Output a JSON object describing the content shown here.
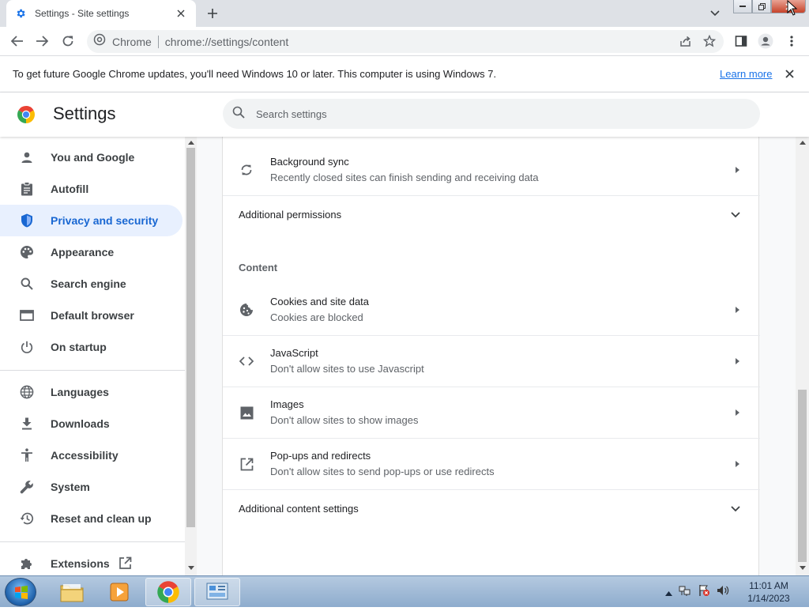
{
  "browser": {
    "tab_title": "Settings - Site settings",
    "omnibox_chip": "Chrome",
    "url": "chrome://settings/content"
  },
  "infobar": {
    "message": "To get future Google Chrome updates, you'll need Windows 10 or later. This computer is using Windows 7.",
    "learn_more": "Learn more"
  },
  "settings": {
    "title": "Settings",
    "search_placeholder": "Search settings"
  },
  "sidebar": {
    "items": [
      {
        "label": "You and Google",
        "icon": "person-icon"
      },
      {
        "label": "Autofill",
        "icon": "clipboard-icon"
      },
      {
        "label": "Privacy and security",
        "icon": "shield-icon",
        "active": true
      },
      {
        "label": "Appearance",
        "icon": "palette-icon"
      },
      {
        "label": "Search engine",
        "icon": "search-icon"
      },
      {
        "label": "Default browser",
        "icon": "browser-window-icon"
      },
      {
        "label": "On startup",
        "icon": "power-icon"
      },
      {
        "label": "Languages",
        "icon": "globe-icon"
      },
      {
        "label": "Downloads",
        "icon": "download-icon"
      },
      {
        "label": "Accessibility",
        "icon": "accessibility-icon"
      },
      {
        "label": "System",
        "icon": "wrench-icon"
      },
      {
        "label": "Reset and clean up",
        "icon": "history-icon"
      },
      {
        "label": "Extensions",
        "icon": "puzzle-icon"
      }
    ]
  },
  "main": {
    "background_sync": {
      "title": "Background sync",
      "subtitle": "Recently closed sites can finish sending and receiving data"
    },
    "additional_permissions": "Additional permissions",
    "content_heading": "Content",
    "content_rows": [
      {
        "title": "Cookies and site data",
        "subtitle": "Cookies are blocked"
      },
      {
        "title": "JavaScript",
        "subtitle": "Don't allow sites to use Javascript"
      },
      {
        "title": "Images",
        "subtitle": "Don't allow sites to show images"
      },
      {
        "title": "Pop-ups and redirects",
        "subtitle": "Don't allow sites to send pop-ups or use redirects"
      }
    ],
    "additional_content": "Additional content settings"
  },
  "taskbar": {
    "time": "11:01 AM",
    "date": "1/14/2023"
  },
  "colors": {
    "accent": "#1a73e8",
    "active_nav_bg": "#e8f0fe",
    "active_nav_text": "#1967d2"
  }
}
